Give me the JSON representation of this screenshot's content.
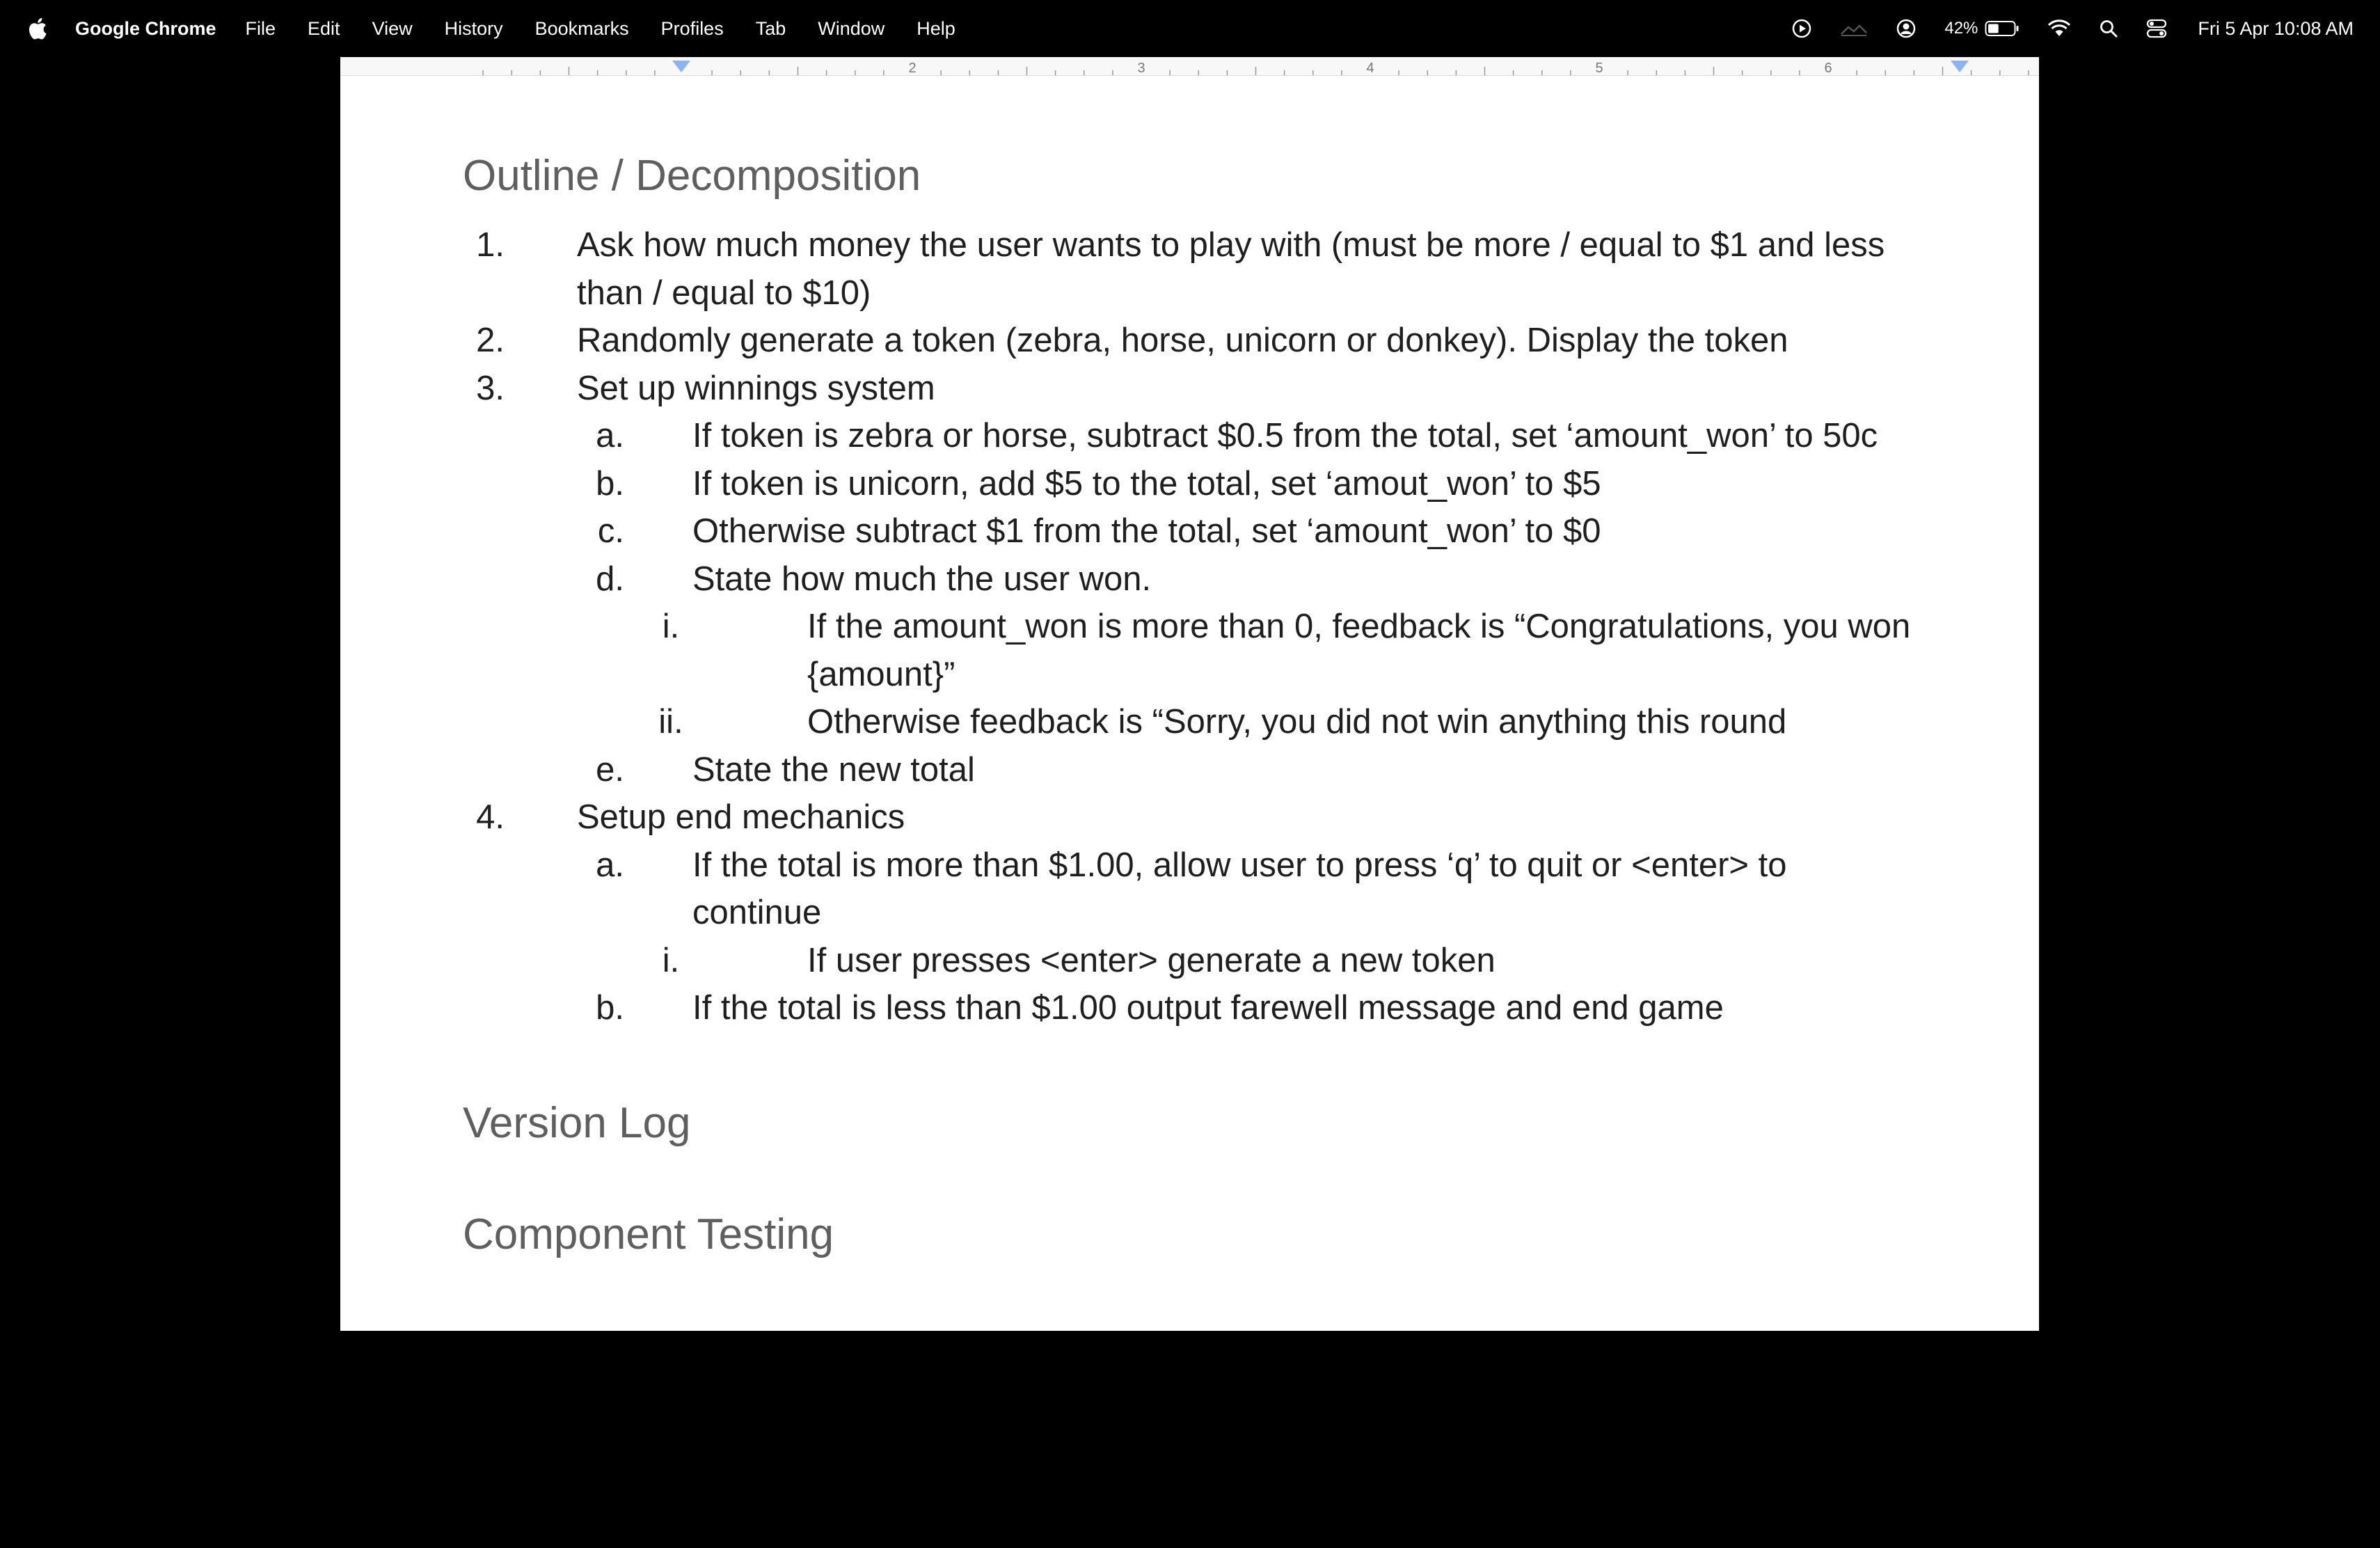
{
  "menubar": {
    "apple_icon": "apple-logo-icon",
    "app_name": "Google Chrome",
    "menus": [
      "File",
      "Edit",
      "View",
      "History",
      "Bookmarks",
      "Profiles",
      "Tab",
      "Window",
      "Help"
    ],
    "status": {
      "battery_percent": "42%",
      "battery_level": 0.42,
      "datetime": "Fri 5 Apr  10:08 AM"
    }
  },
  "ruler": {
    "numbers": [
      "2",
      "3",
      "4",
      "5",
      "6"
    ]
  },
  "document": {
    "heading_outline": "Outline / Decomposition",
    "items": [
      {
        "num": "1.",
        "line1": "Ask how much money the user wants to play with (must be more / equal to $1 and less",
        "line2": "than / equal to $10)"
      },
      {
        "num": "2.",
        "line1": "Randomly generate a token (zebra, horse, unicorn or donkey).  Display the token"
      },
      {
        "num": "3.",
        "line1": "Set up winnings system"
      },
      {
        "num": "a.",
        "line1": "If token is zebra or horse, subtract $0.5 from the total, set ‘amount_won’ to 50c"
      },
      {
        "num": "b.",
        "line1": "If token is unicorn, add $5 to the total, set ‘amout_won’ to $5"
      },
      {
        "num": "c.",
        "line1": "Otherwise subtract $1 from the total, set ‘amount_won’ to $0"
      },
      {
        "num": "d.",
        "line1": "State how much the user won."
      },
      {
        "num": "i.",
        "line1": "If the amount_won is more than 0, feedback is “Congratulations, you won",
        "line2": "{amount}”"
      },
      {
        "num": "ii.",
        "line1": "Otherwise feedback is “Sorry, you did not win anything this round"
      },
      {
        "num": "e.",
        "line1": "State the new total"
      },
      {
        "num": "4.",
        "line1": "Setup end mechanics"
      },
      {
        "num": "a.",
        "line1": "If the total is more than $1.00, allow user to press ‘q’ to quit or <enter> to",
        "line2": "continue"
      },
      {
        "num": "i.",
        "line1": "If user presses <enter> generate a new token"
      },
      {
        "num": "b.",
        "line1": "If the total is less than $1.00 output farewell message and end game"
      }
    ],
    "heading_version_log": "Version Log",
    "heading_component_testing": "Component Testing"
  }
}
